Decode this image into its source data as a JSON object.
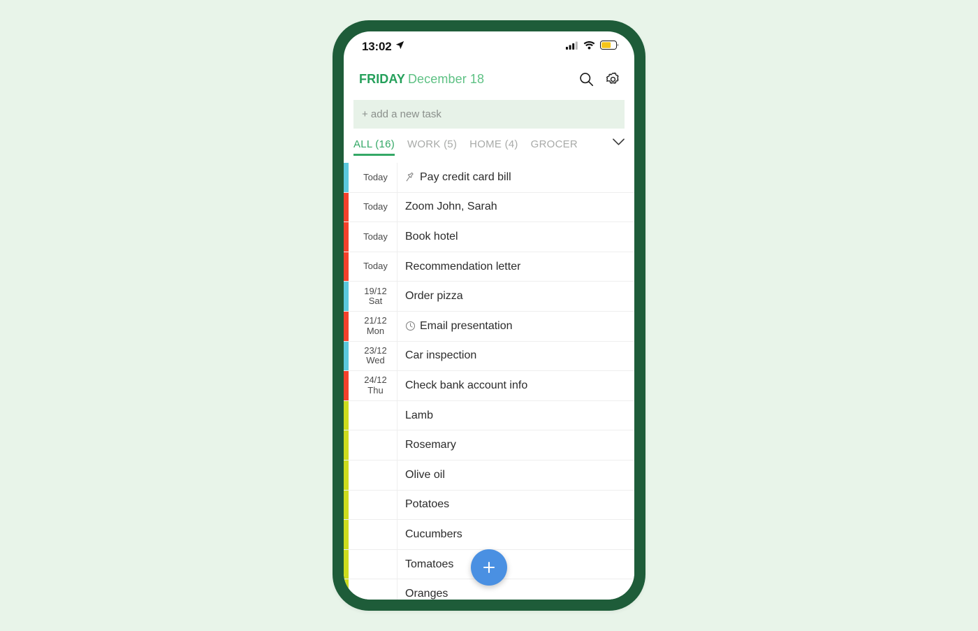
{
  "status_bar": {
    "time": "13:02",
    "location_icon": "location-arrow-icon",
    "cellular_icon": "cellular-signal-icon",
    "wifi_icon": "wifi-icon",
    "battery_icon": "battery-icon",
    "battery_color": "#f5c518"
  },
  "header": {
    "weekday": "FRIDAY",
    "date": "December 18",
    "search_icon": "search-icon",
    "settings_icon": "gear-icon",
    "weekday_color": "#25a05b",
    "date_color": "#5ec184"
  },
  "add_task": {
    "placeholder": "+ add a new task",
    "value": "",
    "background": "#e7f2e8"
  },
  "tabs": {
    "items": [
      {
        "label": "ALL (16)",
        "active": true
      },
      {
        "label": "WORK (5)",
        "active": false
      },
      {
        "label": "HOME (4)",
        "active": false
      },
      {
        "label": "GROCER",
        "active": false
      }
    ],
    "expand_icon": "chevron-down-icon",
    "active_color": "#34a866",
    "inactive_color": "#a8aaa8"
  },
  "colors": {
    "frame": "#1e5c39",
    "page_background": "#e8f4e9",
    "priority_cyan": "#5bc8dd",
    "priority_red": "#f5402c",
    "priority_lime": "#cddc1e",
    "fab": "#4a90e2"
  },
  "fab": {
    "icon": "plus-icon",
    "label": "+"
  },
  "tasks": [
    {
      "date_line1": "Today",
      "date_line2": "",
      "text": "Pay credit card bill",
      "icon": "pin-icon",
      "bar": "#5bc8dd"
    },
    {
      "date_line1": "Today",
      "date_line2": "",
      "text": "Zoom John, Sarah",
      "icon": "",
      "bar": "#f5402c"
    },
    {
      "date_line1": "Today",
      "date_line2": "",
      "text": "Book hotel",
      "icon": "",
      "bar": "#f5402c"
    },
    {
      "date_line1": "Today",
      "date_line2": "",
      "text": "Recommendation letter",
      "icon": "",
      "bar": "#f5402c"
    },
    {
      "date_line1": "19/12",
      "date_line2": "Sat",
      "text": "Order pizza",
      "icon": "",
      "bar": "#5bc8dd"
    },
    {
      "date_line1": "21/12",
      "date_line2": "Mon",
      "text": "Email presentation",
      "icon": "clock-icon",
      "bar": "#f5402c"
    },
    {
      "date_line1": "23/12",
      "date_line2": "Wed",
      "text": "Car inspection",
      "icon": "",
      "bar": "#5bc8dd"
    },
    {
      "date_line1": "24/12",
      "date_line2": "Thu",
      "text": "Check bank account info",
      "icon": "",
      "bar": "#f5402c"
    },
    {
      "date_line1": "",
      "date_line2": "",
      "text": "Lamb",
      "icon": "",
      "bar": "#cddc1e"
    },
    {
      "date_line1": "",
      "date_line2": "",
      "text": "Rosemary",
      "icon": "",
      "bar": "#cddc1e"
    },
    {
      "date_line1": "",
      "date_line2": "",
      "text": "Olive oil",
      "icon": "",
      "bar": "#cddc1e"
    },
    {
      "date_line1": "",
      "date_line2": "",
      "text": "Potatoes",
      "icon": "",
      "bar": "#cddc1e"
    },
    {
      "date_line1": "",
      "date_line2": "",
      "text": "Cucumbers",
      "icon": "",
      "bar": "#cddc1e"
    },
    {
      "date_line1": "",
      "date_line2": "",
      "text": "Tomatoes",
      "icon": "",
      "bar": "#cddc1e"
    },
    {
      "date_line1": "",
      "date_line2": "",
      "text": "Oranges",
      "icon": "",
      "bar": "#cddc1e"
    }
  ]
}
